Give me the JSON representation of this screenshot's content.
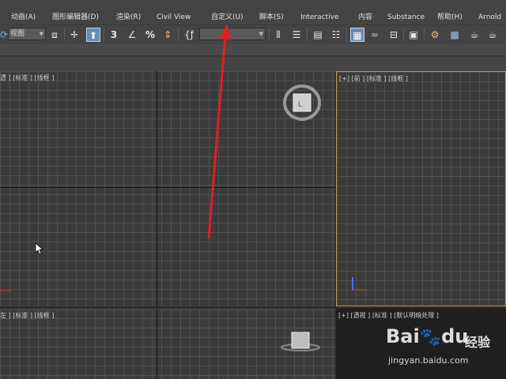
{
  "menu": {
    "items": [
      {
        "label": "动画(A)"
      },
      {
        "label": "图形编辑器(D)"
      },
      {
        "label": "渲染(R)"
      },
      {
        "label": "Civil View"
      },
      {
        "label": "自定义(U)"
      },
      {
        "label": "脚本(S)"
      },
      {
        "label": "Interactive"
      },
      {
        "label": "内容"
      },
      {
        "label": "Substance"
      },
      {
        "label": "帮助(H)"
      },
      {
        "label": "Arnold"
      }
    ]
  },
  "toolbar": {
    "view_dropdown": "视图",
    "percent_snap": "%",
    "angle_snap": "3",
    "named_selection": ""
  },
  "viewports": {
    "top_left": {
      "label": "透 ] [标准 ] [线框 ]"
    },
    "top_right": {
      "label": "[+] [前 ] [标准 ] [线框 ]"
    },
    "bottom_left": {
      "label": "左 ] [标准 ] [线框 ]"
    },
    "bottom_right": {
      "label": "[+] [透视 ] [标准 ] [默认明暗处理 ]"
    }
  },
  "viewcube": {
    "top_left_face": "L",
    "top_right_face": ""
  },
  "watermark": {
    "logo": "Bai",
    "logo_suffix": "du",
    "cn": "经验",
    "url": "jingyan.baidu.com"
  },
  "colors": {
    "accent_active": "#6a8bb0",
    "active_viewport_border": "#b99b4b",
    "annotation_arrow": "#e02020"
  }
}
